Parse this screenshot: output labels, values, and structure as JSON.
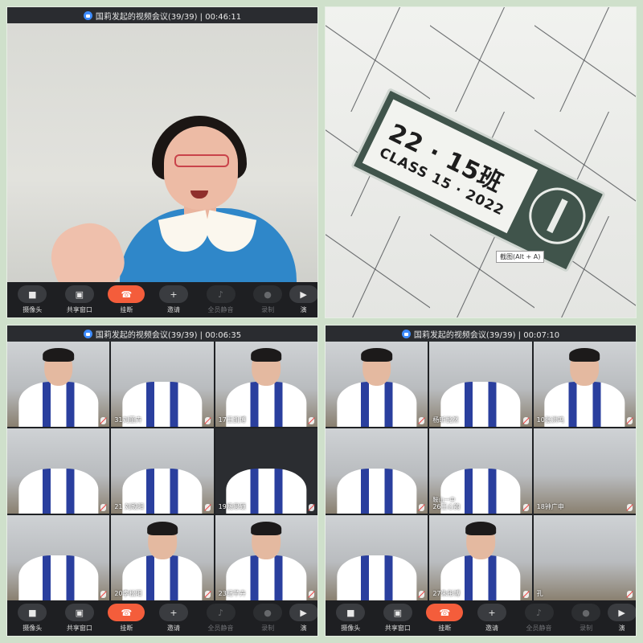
{
  "panels": [
    {
      "title": "国莉发起的视频会议(39/39) | 00:46:11"
    },
    {
      "tooltip": "截图(Alt + A)",
      "sign_number": "22 · 15班",
      "sign_class": "CLASS 15 · 2022"
    },
    {
      "title": "国莉发起的视频会议(39/39) | 00:06:35",
      "tiles": [
        {
          "label": "",
          "dark": false
        },
        {
          "label": "31刘董卉",
          "dark": false
        },
        {
          "label": "17王凯博",
          "dark": false
        },
        {
          "label": "",
          "dark": false
        },
        {
          "label": "21 刘殿阳",
          "dark": false
        },
        {
          "label": "19杨思硕",
          "dark": false
        },
        {
          "label": "",
          "dark": false
        },
        {
          "label": "20李松阳",
          "dark": false
        },
        {
          "label": "23纪芊卉",
          "dark": false
        }
      ]
    },
    {
      "title": "国莉发起的视频会议(39/39) | 00:07:10",
      "tiles": [
        {
          "label": "",
          "sub": ""
        },
        {
          "label": "杨昕悦然",
          "sub": ""
        },
        {
          "label": "10张洪鸣",
          "sub": ""
        },
        {
          "label": "",
          "sub": ""
        },
        {
          "label": "26王心韵",
          "sub": "鞍山一中"
        },
        {
          "label": "18钟广申",
          "sub": ""
        },
        {
          "label": "",
          "sub": ""
        },
        {
          "label": "27朱彤博",
          "sub": ""
        },
        {
          "label": "孔",
          "sub": ""
        }
      ]
    }
  ],
  "toolbar": {
    "camera": "摄像头",
    "share": "共享窗口",
    "hangup": "挂断",
    "invite": "邀请",
    "mute_all": "全员静音",
    "record": "录制",
    "more": "演"
  },
  "icons": {
    "camera": "video-camera-icon",
    "share": "share-window-icon",
    "hangup": "phone-hangup-icon",
    "invite": "add-user-icon",
    "mute_all": "mute-all-icon",
    "record": "record-icon"
  },
  "colors": {
    "hangup": "#f45d3b",
    "lock": "#3d8bfd",
    "toolbar_bg": "#1e1f22"
  }
}
